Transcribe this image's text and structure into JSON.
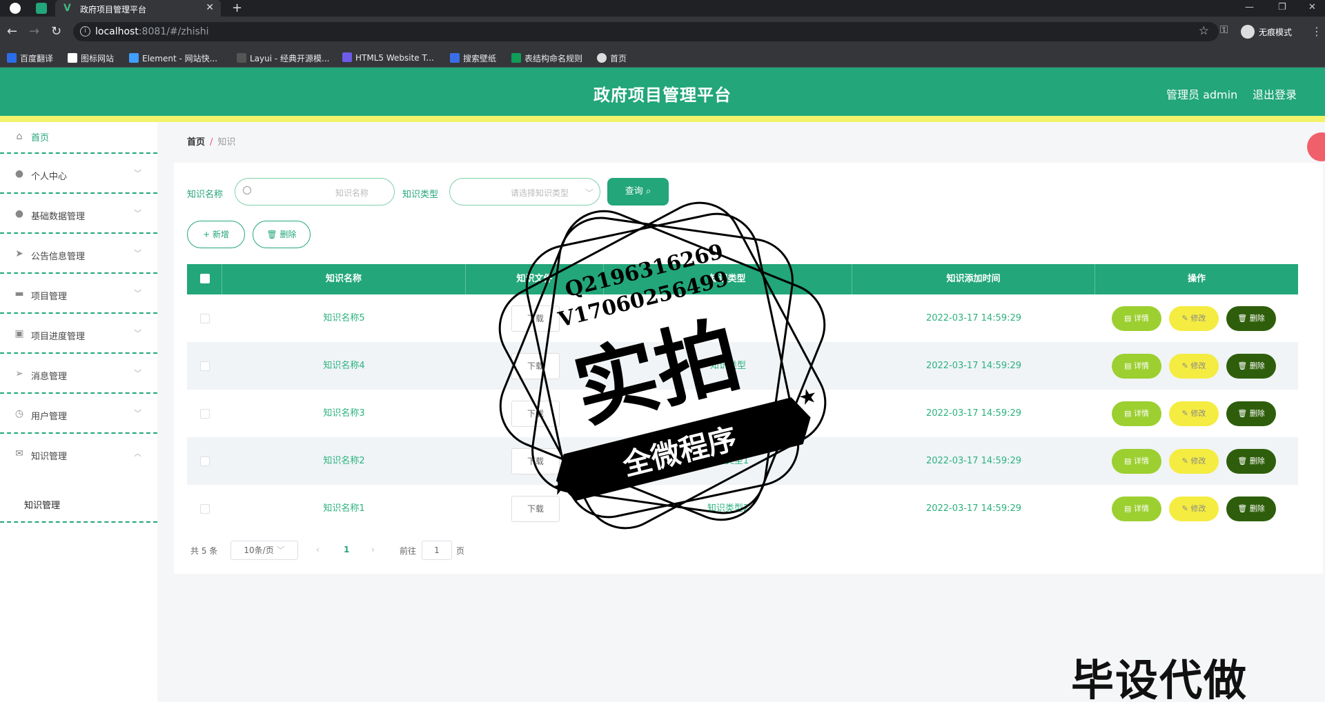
{
  "browser": {
    "tab_title": "政府项目管理平台",
    "url_host": "localhost",
    "url_path": ":8081/#/zhishi",
    "incognito_label": "无痕模式",
    "bookmarks": [
      "百度翻译",
      "图标网站",
      "Element - 网站快...",
      "Layui - 经典开源模...",
      "HTML5 Website T...",
      "搜索壁纸",
      "表结构命名规则",
      "首页"
    ]
  },
  "header": {
    "title": "政府项目管理平台",
    "user": "管理员 admin",
    "logout": "退出登录"
  },
  "sidebar": {
    "items": [
      {
        "label": "首页",
        "icon": "home-icon"
      },
      {
        "label": "个人中心",
        "icon": "user-icon"
      },
      {
        "label": "基础数据管理",
        "icon": "user-icon"
      },
      {
        "label": "公告信息管理",
        "icon": "send-icon"
      },
      {
        "label": "项目管理",
        "icon": "chat-icon"
      },
      {
        "label": "项目进度管理",
        "icon": "clipboard-icon"
      },
      {
        "label": "消息管理",
        "icon": "send-icon"
      },
      {
        "label": "用户管理",
        "icon": "clock-icon"
      },
      {
        "label": "知识管理",
        "icon": "mail-icon"
      }
    ],
    "submenu_label": "知识管理"
  },
  "breadcrumb": {
    "home": "首页",
    "current": "知识"
  },
  "filters": {
    "name_label": "知识名称",
    "name_placeholder": "知识名称",
    "type_label": "知识类型",
    "type_placeholder": "请选择知识类型",
    "query_button": "查询"
  },
  "toolbar": {
    "add": "+ 新增",
    "delete": "删除"
  },
  "table": {
    "columns": [
      "知识名称",
      "知识文件",
      "知识类型",
      "知识添加时间",
      "操作"
    ],
    "download_label": "下载",
    "rows": [
      {
        "name": "知识名称5",
        "type": "",
        "time": "2022-03-17 14:59:29"
      },
      {
        "name": "知识名称4",
        "type": "知识类型",
        "time": "2022-03-17 14:59:29"
      },
      {
        "name": "知识名称3",
        "type": "",
        "time": "2022-03-17 14:59:29"
      },
      {
        "name": "知识名称2",
        "type": "知识类型1",
        "time": "2022-03-17 14:59:29"
      },
      {
        "name": "知识名称1",
        "type": "知识类型2",
        "time": "2022-03-17 14:59:29"
      }
    ],
    "actions": {
      "detail": "详情",
      "edit": "修改",
      "delete": "删除"
    }
  },
  "pagination": {
    "total": "共 5 条",
    "page_size": "10条/页",
    "current_page": "1",
    "goto_label": "前往",
    "goto_value": "1",
    "page_suffix": "页"
  },
  "overlay": {
    "stamp_line1": "Q2196316269",
    "stamp_line2": "V17060256499",
    "stamp_big": "实拍",
    "stamp_banner": "全微程序",
    "bottom_text": "毕设代做"
  },
  "colors": {
    "primary": "#22a67a",
    "stripe": "#f2f36a",
    "detail": "#9ccf30",
    "edit": "#f4ec41",
    "delete": "#2e5e0b"
  }
}
